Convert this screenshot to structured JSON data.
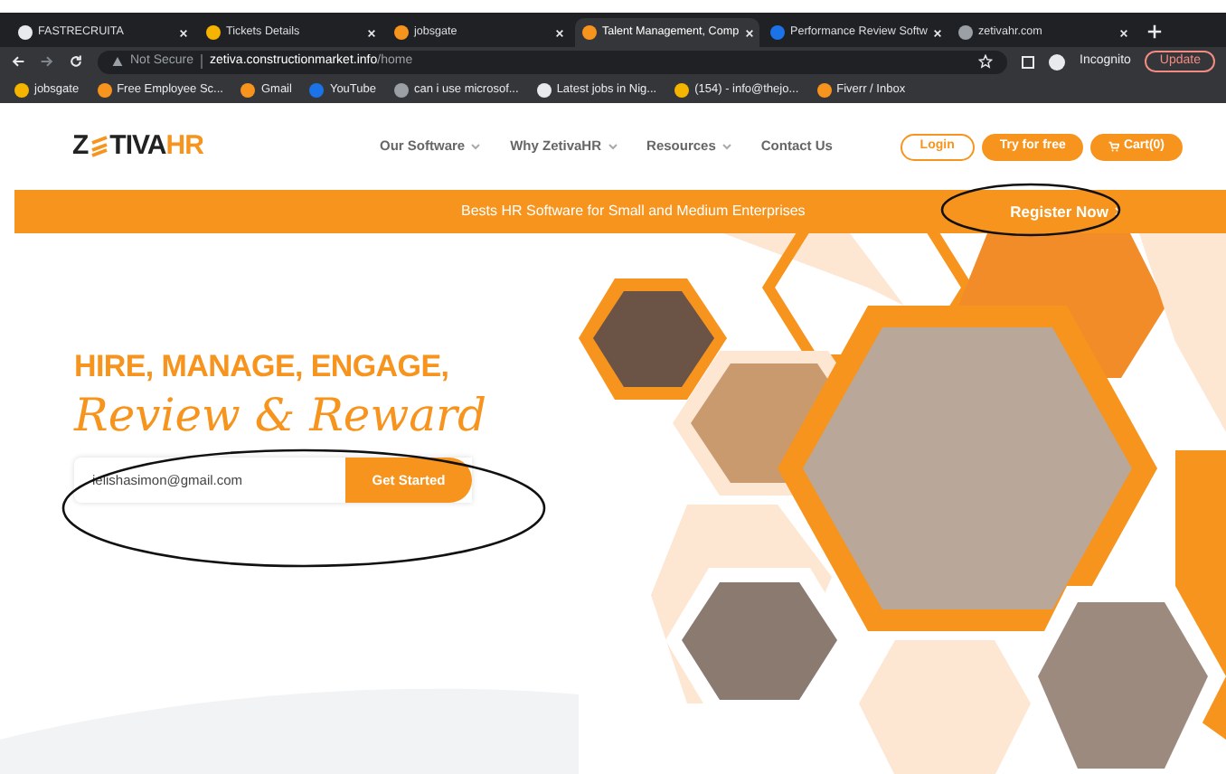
{
  "browser": {
    "tabs": [
      {
        "title": "FASTRECRUITA",
        "selected": false
      },
      {
        "title": "Tickets Details",
        "selected": false
      },
      {
        "title": "jobsgate",
        "selected": false
      },
      {
        "title": "Talent Management, Comp",
        "selected": true
      },
      {
        "title": "Performance Review Softw",
        "selected": false
      },
      {
        "title": "zetivahr.com",
        "selected": false
      }
    ],
    "security": "Not Secure",
    "url_host": "zetiva.constructionmarket.info",
    "url_path": "/home",
    "profile": "Incognito",
    "update_button": "Update",
    "bookmarks": [
      "jobsgate",
      "Free Employee Sc...",
      "Gmail",
      "YouTube",
      "can i use microsof...",
      "Latest jobs in Nig...",
      "(154) - info@thejo...",
      "Fiverr / Inbox"
    ]
  },
  "site": {
    "logo": {
      "start": "Z",
      "middle": "TIVA",
      "end": "HR"
    },
    "nav": [
      {
        "label": "Our Software",
        "has_dropdown": true
      },
      {
        "label": "Why ZetivaHR",
        "has_dropdown": true
      },
      {
        "label": "Resources",
        "has_dropdown": true
      },
      {
        "label": "Contact Us",
        "has_dropdown": false
      }
    ],
    "actions": [
      {
        "label": "Login",
        "kind": "outline"
      },
      {
        "label": "Try for free",
        "kind": "filled"
      },
      {
        "label": "Cart(0)",
        "kind": "cart"
      }
    ],
    "banner": {
      "text": "Bests HR Software for Small and Medium Enterprises",
      "link": "Register Now"
    },
    "hero": {
      "headline": "HIRE, MANAGE, ENGAGE,",
      "script_line": "Review & Reward",
      "email_value": "ielishasimon@gmail.com",
      "cta": "Get Started"
    }
  }
}
